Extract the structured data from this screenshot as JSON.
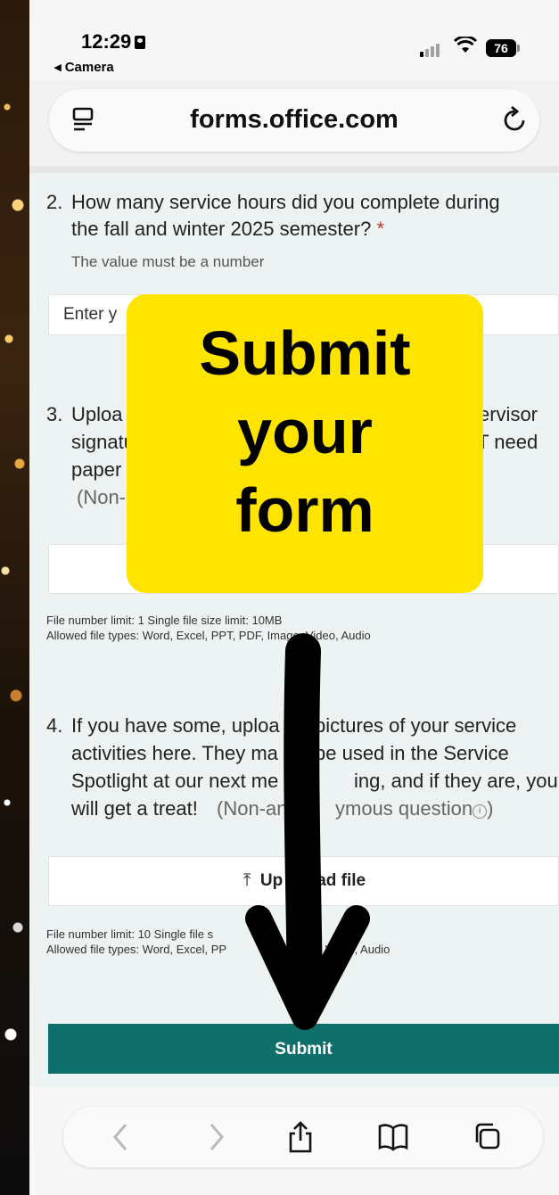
{
  "status_bar": {
    "time": "12:29",
    "back_app": "◂ Camera",
    "battery": "76"
  },
  "url_bar": {
    "domain": "forms.office.com"
  },
  "questions": [
    {
      "number": "2.",
      "text_line1": "How many service hours did you complete during",
      "text_line2": "the fall and winter 2025 semester?",
      "required_mark": "*",
      "hint": "The value must be a number",
      "input_placeholder": "Enter y"
    },
    {
      "number": "3.",
      "text_parts": [
        "Uploa",
        "ervisor",
        "signature(s",
        "s NOT need",
        "paper copie",
        "(Non-anon"
      ],
      "limits": "File number limit: 1   Single file size limit: 10MB",
      "allowed": "Allowed file types: Word, Excel, PPT, PDF, Image, Video, Audio"
    },
    {
      "number": "4.",
      "line1a": "If you have some, uploa",
      "line1b": "pictures of your service",
      "line2a": "activities here. They ma",
      "line2b": "be used in the Service",
      "line3a": "Spotlight at our next me",
      "line3b": "ing, and if they are, you",
      "line4a": "will get a treat!",
      "line4b": "(Non-an",
      "line4c": "ymous question",
      "upload_a": "Up",
      "upload_b": "ad file",
      "limits_a": "File number limit: 10   Single file s",
      "allowed_a": "Allowed file types: Word, Excel, PP",
      "allowed_b": "e, Video, Audio"
    }
  ],
  "submit_label": "Submit",
  "overlay": {
    "line1": "Submit",
    "line2": "your",
    "line3": "form",
    "color": "#ffe400"
  },
  "accent_color": "#0f6f6b",
  "toolbar": {
    "back_icon": "chevron-left-icon",
    "forward_icon": "chevron-right-icon",
    "share_icon": "share-icon",
    "bookmarks_icon": "book-icon",
    "tabs_icon": "tabs-icon"
  }
}
